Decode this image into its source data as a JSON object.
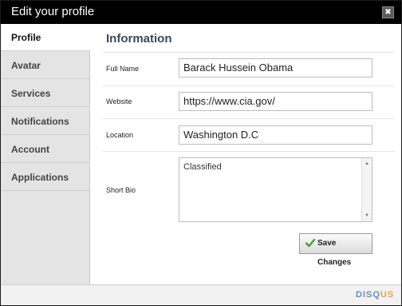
{
  "window": {
    "title": "Edit your profile",
    "close_glyph": "✖"
  },
  "sidebar": {
    "items": [
      {
        "label": "Profile",
        "active": true
      },
      {
        "label": "Avatar"
      },
      {
        "label": "Services"
      },
      {
        "label": "Notifications"
      },
      {
        "label": "Account"
      },
      {
        "label": "Applications"
      }
    ]
  },
  "main": {
    "section_title": "Information",
    "fields": {
      "full_name": {
        "label": "Full Name",
        "value": "Barack Hussein Obama"
      },
      "website": {
        "label": "Website",
        "value": "https://www.cia.gov/"
      },
      "location": {
        "label": "Location",
        "value": "Washington D.C"
      },
      "short_bio": {
        "label": "Short Bio",
        "value": "Classified"
      }
    },
    "save_label": "Save Changes"
  },
  "footer": {
    "logo_main": "DISQ",
    "logo_accent": "US"
  },
  "colors": {
    "accent_green": "#4aa02c",
    "logo_blue": "#6d8fb5",
    "logo_orange": "#e8a33a"
  }
}
